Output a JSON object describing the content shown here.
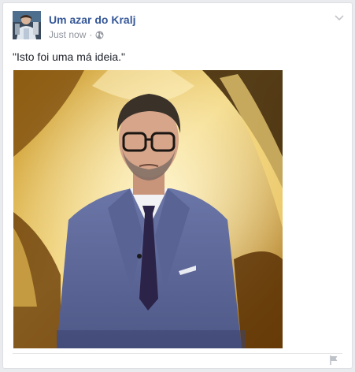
{
  "post": {
    "author": "Um azar do Kralj",
    "timestamp": "Just now",
    "separator": "·",
    "privacy_icon": "globe-icon",
    "text": "\"Isto foi uma má ideia.\"",
    "menu_icon": "chevron-down-icon",
    "report_icon": "flag-icon"
  },
  "colors": {
    "author_link": "#365899",
    "meta_text": "#90949c",
    "body_text": "#1d2129",
    "card_border": "#dddfe2",
    "page_bg": "#e9ebee"
  }
}
